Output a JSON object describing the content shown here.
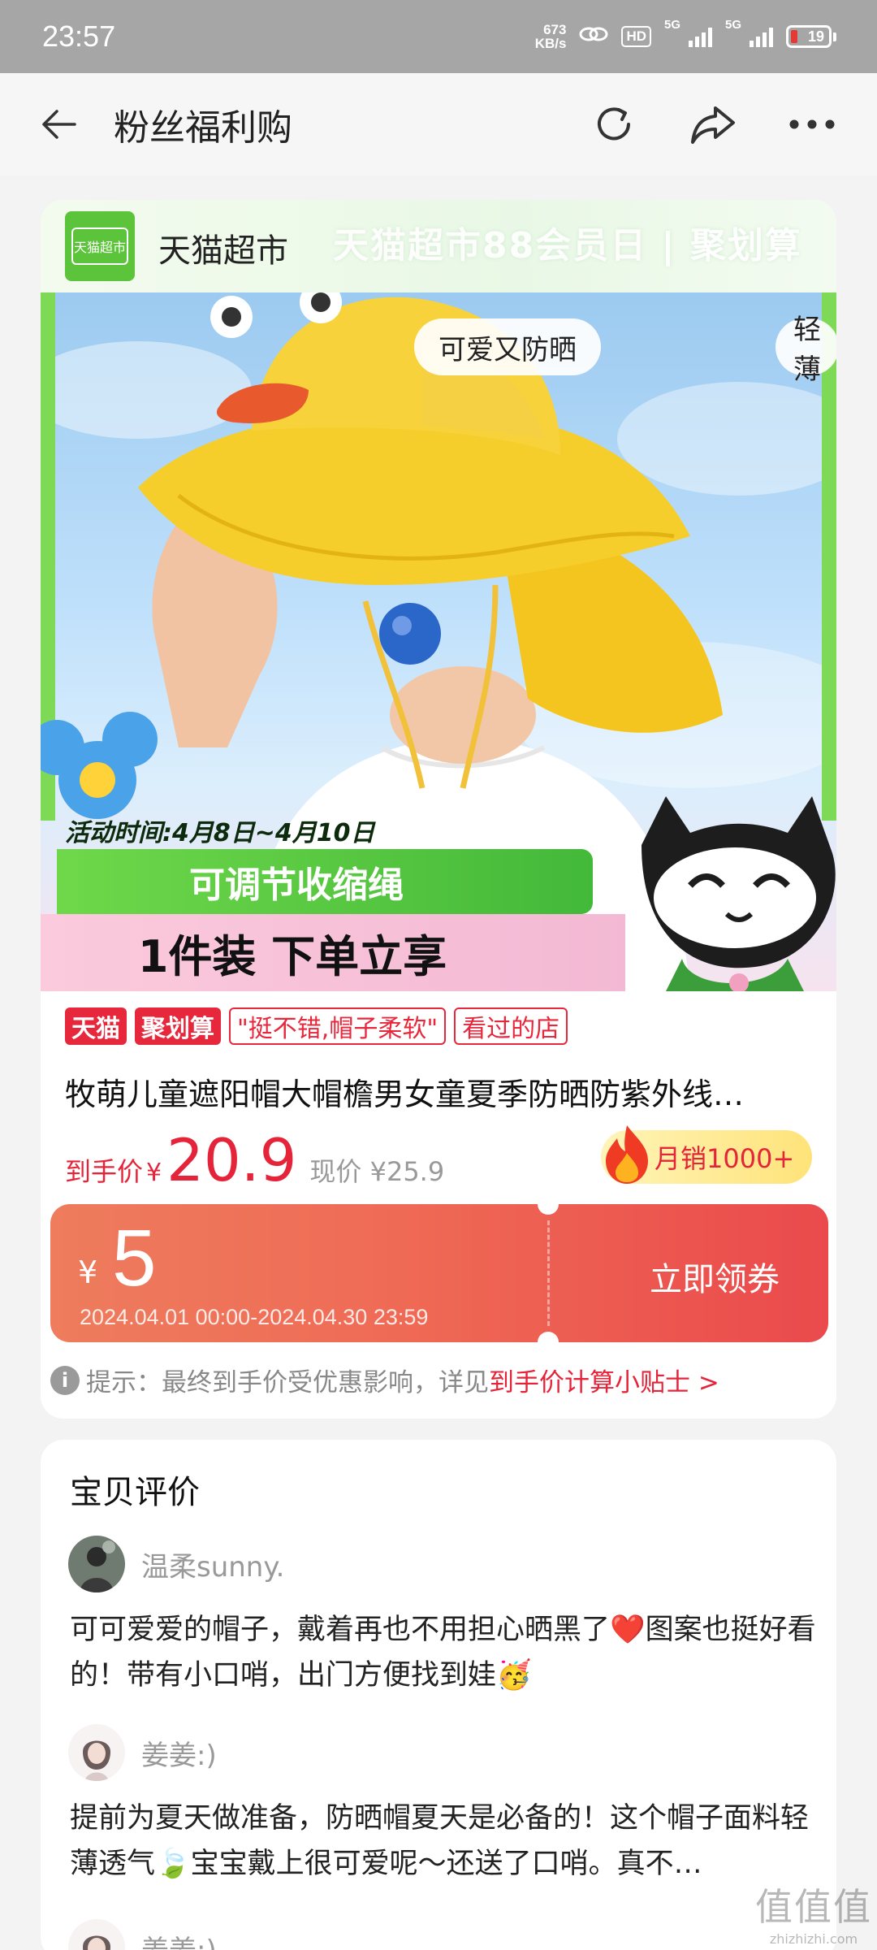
{
  "status_bar": {
    "time": "23:57",
    "net_speed_value": "673",
    "net_speed_unit": "KB/s",
    "hd_label": "HD",
    "signal1_label": "5G",
    "signal2_label": "5G",
    "battery": "19"
  },
  "nav": {
    "title": "粉丝福利购",
    "icons": [
      "back-arrow-icon",
      "refresh-icon",
      "share-icon",
      "more-icon"
    ]
  },
  "store": {
    "logo_text": "天猫超市",
    "name": "天猫超市",
    "banner_text": "天猫超市88会员日 | 聚划算"
  },
  "product_image": {
    "feature_tags": [
      "可爱又防晒",
      "轻薄"
    ],
    "promo_period": "活动时间:4月8日~4月10日",
    "promo_line1": "可调节收缩绳",
    "promo_line2": "1件装 下单立享"
  },
  "badges": [
    "天猫",
    "聚划算",
    "\"挺不错,帽子柔软\"",
    "看过的店"
  ],
  "product": {
    "title": "牧萌儿童遮阳帽大帽檐男女童夏季防晒防紫外线…",
    "price_label": "到手价",
    "currency": "¥",
    "price": "20.9",
    "original_price": "现价 ¥25.9",
    "monthly_sales": "月销1000+"
  },
  "coupon": {
    "currency": "¥",
    "amount": "5",
    "validity": "2024.04.01 00:00-2024.04.30 23:59",
    "button": "立即领券"
  },
  "tip": {
    "prefix": "提示：最终到手价受优惠影响，详见",
    "link": "到手价计算小贴士 >"
  },
  "reviews": {
    "title": "宝贝评价",
    "items": [
      {
        "user": "温柔sunny.",
        "text": "可可爱爱的帽子，戴着再也不用担心晒黑了❤️图案也挺好看的！带有小口哨，出门方便找到娃🥳"
      },
      {
        "user": "姜姜:)",
        "text": "提前为夏天做准备，防晒帽夏天是必备的！这个帽子面料轻薄透气🍃宝宝戴上很可爱呢～还送了口哨。真不…"
      },
      {
        "user": "姜姜:)"
      }
    ]
  },
  "watermark": {
    "main": "值值值",
    "site": "zhizhizhi.com"
  },
  "colors": {
    "accent_red": "#e5243a",
    "tmall_green": "#5cc43a",
    "coupon_start": "#ee7c5d",
    "coupon_end": "#ea4a4c"
  }
}
